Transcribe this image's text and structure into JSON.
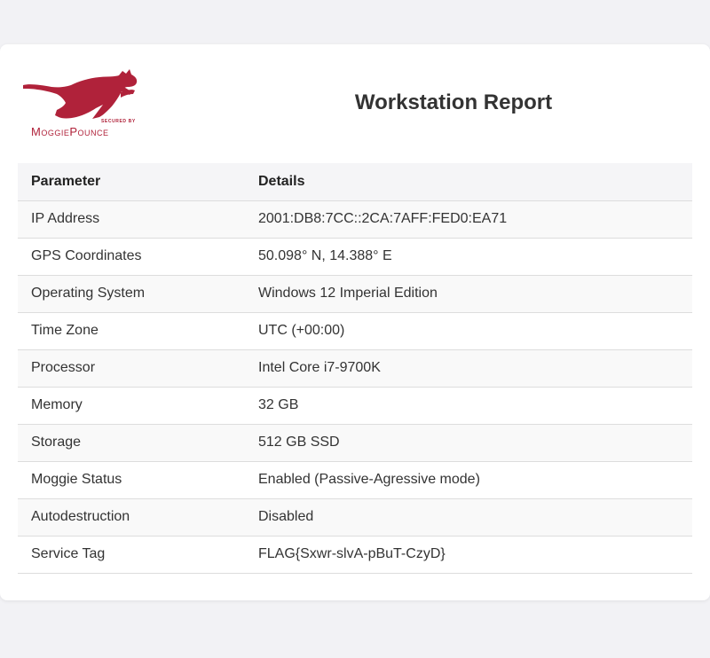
{
  "logo": {
    "icon": "pouncing-cat-icon",
    "secured_by": "SECURED BY",
    "brand": "MoggiePounce",
    "color": "#b0223a"
  },
  "title": "Workstation Report",
  "table": {
    "headers": [
      "Parameter",
      "Details"
    ],
    "rows": [
      {
        "parameter": "IP Address",
        "details": "2001:DB8:7CC::2CA:7AFF:FED0:EA71"
      },
      {
        "parameter": "GPS Coordinates",
        "details": "50.098° N, 14.388° E"
      },
      {
        "parameter": "Operating System",
        "details": "Windows 12 Imperial Edition"
      },
      {
        "parameter": "Time Zone",
        "details": "UTC (+00:00)"
      },
      {
        "parameter": "Processor",
        "details": "Intel Core i7-9700K"
      },
      {
        "parameter": "Memory",
        "details": "32 GB"
      },
      {
        "parameter": "Storage",
        "details": "512 GB SSD"
      },
      {
        "parameter": "Moggie Status",
        "details": "Enabled (Passive-Agressive mode)"
      },
      {
        "parameter": "Autodestruction",
        "details": "Disabled"
      },
      {
        "parameter": "Service Tag",
        "details": "FLAG{Sxwr-slvA-pBuT-CzyD}"
      }
    ]
  }
}
